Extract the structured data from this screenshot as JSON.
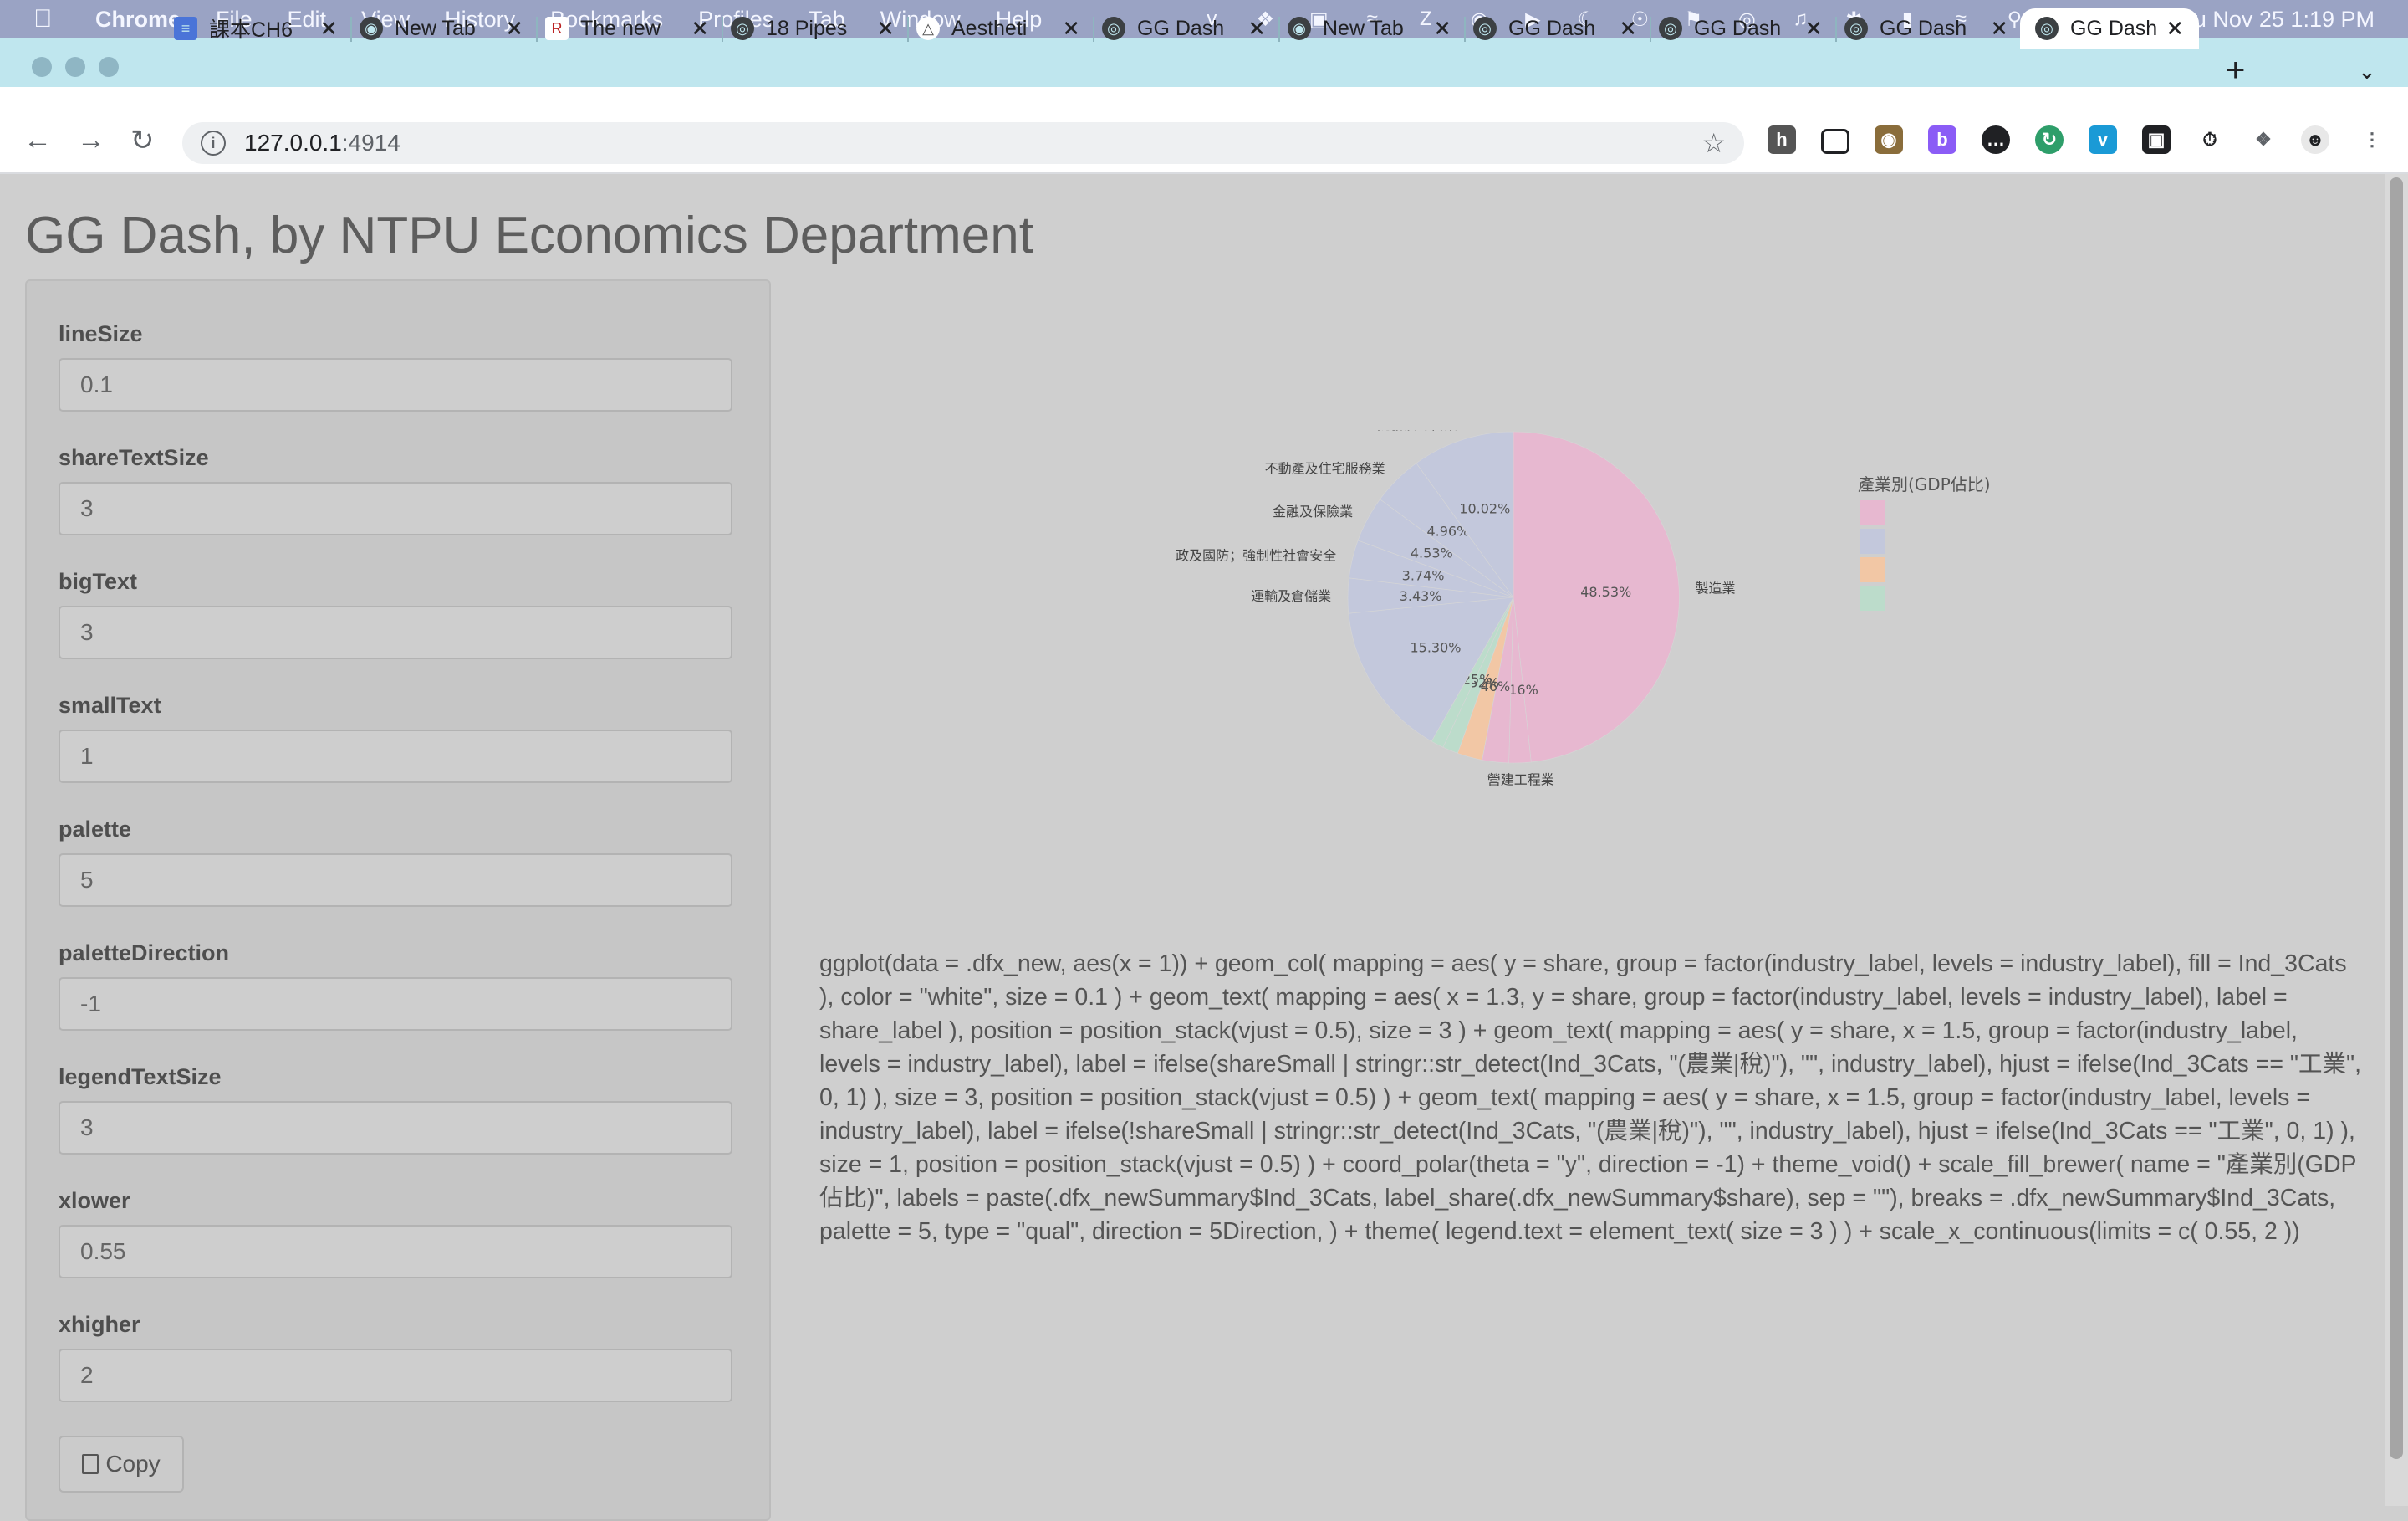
{
  "menubar": {
    "app": "Chrome",
    "items": [
      "File",
      "Edit",
      "View",
      "History",
      "Bookmarks",
      "Profiles",
      "Tab",
      "Window",
      "Help"
    ],
    "clock": "Thu Nov 25  1:19 PM"
  },
  "tabs": [
    {
      "title": "課本CH6",
      "icon": "docs-icon"
    },
    {
      "title": "New Tab",
      "icon": "chrome-icon"
    },
    {
      "title": "The new",
      "icon": "r-icon"
    },
    {
      "title": "18 Pipes",
      "icon": "globe-icon"
    },
    {
      "title": "Aestheti",
      "icon": "cran-icon"
    },
    {
      "title": "GG Dash",
      "icon": "globe-icon"
    },
    {
      "title": "New Tab",
      "icon": "chrome-icon"
    },
    {
      "title": "GG Dash",
      "icon": "globe-icon"
    },
    {
      "title": "GG Dash",
      "icon": "globe-icon"
    },
    {
      "title": "GG Dash",
      "icon": "globe-icon"
    },
    {
      "title": "GG Dash",
      "icon": "globe-icon",
      "active": true
    }
  ],
  "address": {
    "host": "127.0.0.1",
    "port": ":4914"
  },
  "page": {
    "title": "GG Dash, by NTPU Economics Department",
    "fields": [
      {
        "label": "lineSize",
        "value": "0.1"
      },
      {
        "label": "shareTextSize",
        "value": "3"
      },
      {
        "label": "bigText",
        "value": "3"
      },
      {
        "label": "smallText",
        "value": "1"
      },
      {
        "label": "palette",
        "value": "5"
      },
      {
        "label": "paletteDirection",
        "value": "-1"
      },
      {
        "label": "legendTextSize",
        "value": "3"
      },
      {
        "label": "xlower",
        "value": "0.55"
      },
      {
        "label": "xhigher",
        "value": "2"
      }
    ],
    "copy_label": "Copy",
    "code": "ggplot(data = .dfx_new, aes(x = 1)) + geom_col( mapping = aes( y = share, group = factor(industry_label, levels = industry_label), fill = Ind_3Cats ), color = \"white\", size = 0.1 ) + geom_text( mapping = aes( x = 1.3, y = share, group = factor(industry_label, levels = industry_label), label = share_label ), position = position_stack(vjust = 0.5), size = 3 ) + geom_text( mapping = aes( y = share, x = 1.5, group = factor(industry_label, levels = industry_label), label = ifelse(shareSmall | stringr::str_detect(Ind_3Cats, \"(農業|稅)\"), \"\", industry_label), hjust = ifelse(Ind_3Cats == \"工業\", 0, 1) ), size = 3, position = position_stack(vjust = 0.5) ) + geom_text( mapping = aes( y = share, x = 1.5, group = factor(industry_label, levels = industry_label), label = ifelse(!shareSmall | stringr::str_detect(Ind_3Cats, \"(農業|稅)\"), \"\", industry_label), hjust = ifelse(Ind_3Cats == \"工業\", 0, 1) ), size = 1, position = position_stack(vjust = 0.5) ) + coord_polar(theta = \"y\", direction = -1) + theme_void() + scale_fill_brewer( name = \"產業別(GDP佔比)\", labels = paste(.dfx_newSummary$Ind_3Cats, label_share(.dfx_newSummary$share), sep = \"\"), breaks = .dfx_newSummary$Ind_3Cats, palette = 5, type = \"qual\", direction = 5Direction, ) + theme( legend.text = element_text( size = 3 ) ) + scale_x_continuous(limits = c( 0.55, 2 ))"
  },
  "chart_data": {
    "type": "pie",
    "legend_title": "產業別(GDP佔比)",
    "legend_position": "right",
    "slices": [
      {
        "label": "製造業",
        "share_label": "48.53%",
        "value": 48.53,
        "color": "#e7b8d0"
      },
      {
        "label": "營建工程業",
        "share_label": "2.16%",
        "value": 2.16,
        "color": "#e7b8d0"
      },
      {
        "label": "",
        "share_label": "",
        "value": 2.6,
        "color": "#e7b8d0"
      },
      {
        "label": "",
        "share_label": "2.46%",
        "value": 2.46,
        "color": "#f2c7a5"
      },
      {
        "label": "",
        "share_label": "1.52%",
        "value": 1.52,
        "color": "#bcdccb"
      },
      {
        "label": "",
        "share_label": "1.25%",
        "value": 1.25,
        "color": "#bcdccb"
      },
      {
        "label": "",
        "share_label": "15.30%",
        "value": 15.3,
        "color": "#c3c8dc"
      },
      {
        "label": "運輸及倉儲業",
        "share_label": "3.43%",
        "value": 3.43,
        "color": "#c3c8dc"
      },
      {
        "label": "政及國防；強制性社會安全",
        "share_label": "3.74%",
        "value": 3.74,
        "color": "#c3c8dc"
      },
      {
        "label": "金融及保險業",
        "share_label": "4.53%",
        "value": 4.53,
        "color": "#c3c8dc"
      },
      {
        "label": "不動產及住宅服務業",
        "share_label": "4.96%",
        "value": 4.96,
        "color": "#c3c8dc"
      },
      {
        "label": "批發及零售業",
        "share_label": "10.02%",
        "value": 10.02,
        "color": "#c3c8dc"
      }
    ],
    "legend_colors": [
      "#e7b8d0",
      "#c3c8dc",
      "#f2c7a5",
      "#bcdccb"
    ]
  }
}
